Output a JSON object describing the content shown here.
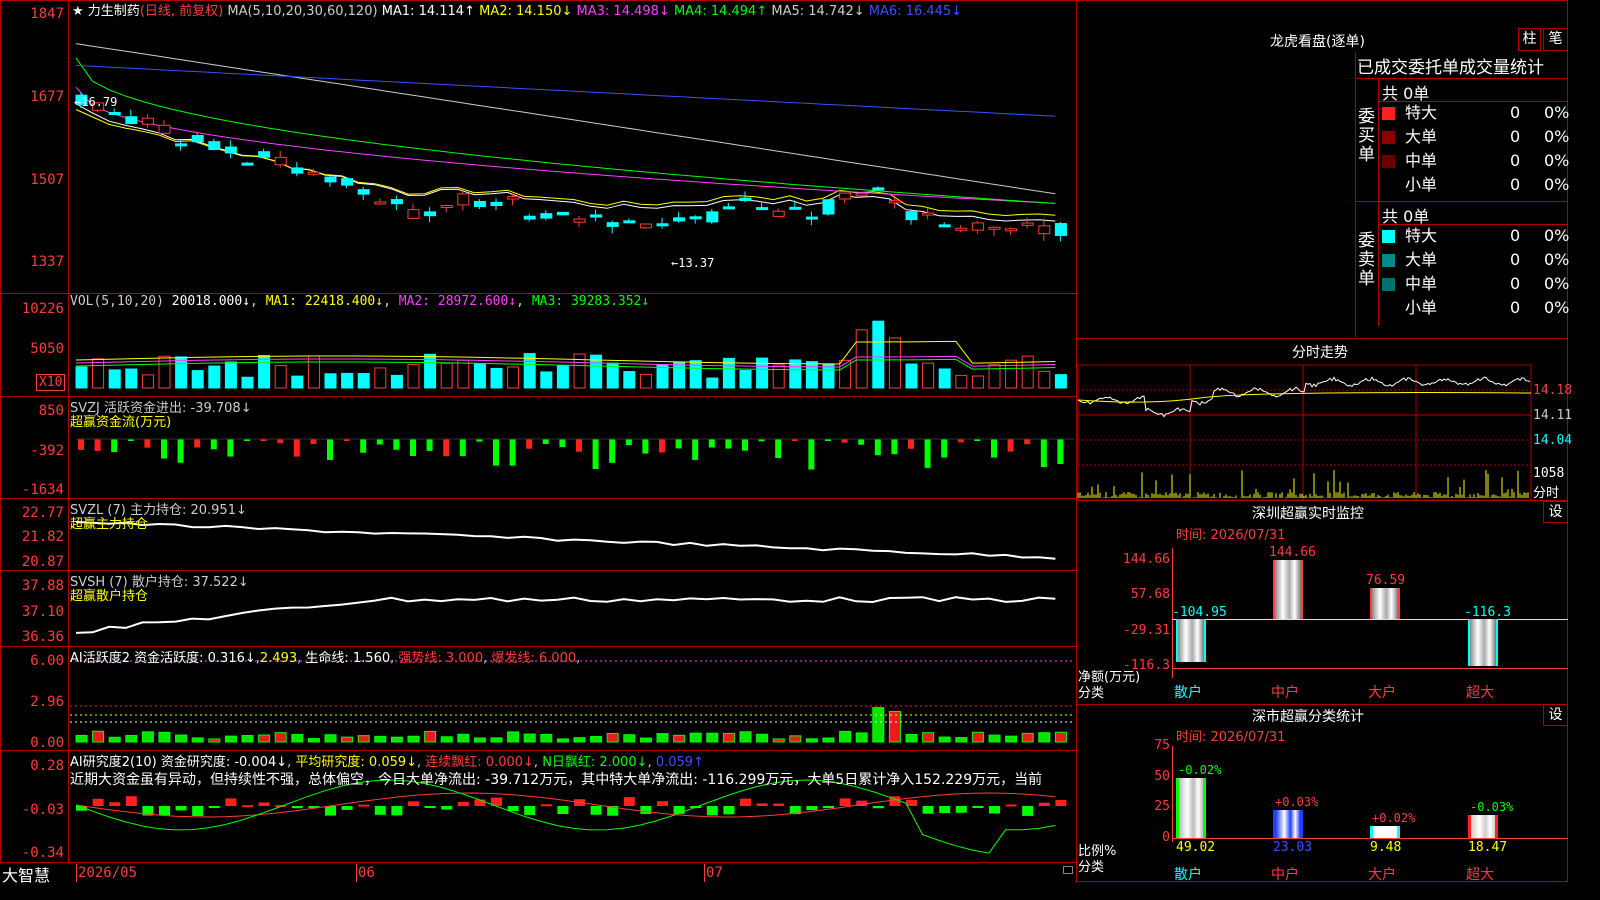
{
  "colors": {
    "up": "#ff3c3c",
    "down": "#00ffff",
    "grid": "#b00000",
    "ma1": "#ffffff",
    "ma2": "#ffff00",
    "ma3": "#ff40ff",
    "ma4": "#00ff00",
    "ma5": "#cccccc",
    "ma6": "#3c50ff"
  },
  "kline": {
    "star": "★",
    "title": "力生制药",
    "period": "(日线, 前复权)",
    "ma_label": "MA(5,10,20,30,60,120)",
    "ma1": "MA1: 14.114↑",
    "ma2": "MA2: 14.150↓",
    "ma3": "MA3: 14.498↓",
    "ma4": "MA4: 14.494↑",
    "ma5": "MA5: 14.742↓",
    "ma6": "MA6: 16.445↓",
    "yaxis": [
      "1847",
      "1677",
      "1507",
      "1337"
    ],
    "high_label": "←16.79",
    "low_label": "←13.37"
  },
  "vol": {
    "label": "VOL(5,10,20)",
    "val": "20018.000↓",
    "ma1": "MA1: 22418.400↓",
    "ma2": "MA2: 28972.600↓",
    "ma3": "MA3: 39283.352↓",
    "yaxis": [
      "10226",
      "5050"
    ],
    "unit": "X10"
  },
  "svzj": {
    "label": "SVZJ  活跃资金进出: -39.708↓",
    "sub": "超赢资金流(万元)",
    "yaxis": [
      "850",
      "-392",
      "-1634"
    ]
  },
  "svzl": {
    "label": "SVZL (7) 主力持仓: 20.951↓",
    "sub": "超赢主力持仓",
    "yaxis": [
      "22.77",
      "21.82",
      "20.87"
    ]
  },
  "svsh": {
    "label": "SVSH (7) 散户持仓: 37.522↓",
    "sub": "超赢散户持仓",
    "yaxis": [
      "37.88",
      "37.10",
      "36.36"
    ]
  },
  "ai1": {
    "a": "AI活跃度2 资金活跃度: 0.316↓",
    "b": "2.493",
    "c": "生命线: 1.560",
    "d": "强势线: 3.000",
    "e": "爆发线: 6.000",
    "yaxis": [
      "6.00",
      "2.96",
      "0.00"
    ]
  },
  "ai2": {
    "a": "AI研究度2(10) 资金研究度: -0.004↓",
    "b": "平均研究度: 0.059↓",
    "c": "连续飘红: 0.000↓",
    "d": "N日飘红: 2.000↓",
    "e": "0.059↑",
    "note": "近期大资金虽有异动，但持续性不强，总体偏空，今日大单净流出: -39.712万元，其中特大单净流出: -116.299万元，大单5日累计净入152.229万元，当前",
    "yaxis": [
      "0.28",
      "-0.03",
      "-0.34"
    ]
  },
  "xaxis": {
    "d1": "2026/05",
    "d2": "06",
    "d3": "07"
  },
  "brand": "大智慧",
  "lhkp": {
    "title": "龙虎看盘(逐单)",
    "btn1": "柱",
    "btn2": "笔",
    "header": "已成交委托单成交量统计",
    "buy_title": "委买单",
    "sell_title": "委卖单",
    "buy_total": "共 0单",
    "sell_total": "共 0单",
    "rows": [
      {
        "label": "特大",
        "val": "0",
        "pct": "0%"
      },
      {
        "label": "大单",
        "val": "0",
        "pct": "0%"
      },
      {
        "label": "中单",
        "val": "0",
        "pct": "0%"
      },
      {
        "label": "小单",
        "val": "0",
        "pct": "0%"
      }
    ]
  },
  "fenshi": {
    "title": "分时走势",
    "yaxis": [
      "14.18",
      "14.11",
      "14.04"
    ],
    "vol": "1058",
    "unit": "分时"
  },
  "szmon": {
    "title": "深圳超赢实时监控",
    "btn": "设",
    "time": "时间: 2026/07/31",
    "yaxis": [
      "144.66",
      "57.68",
      "-29.31",
      "-116.3"
    ],
    "ylabel": "净额(万元)",
    "xlabel": "分类",
    "cats": [
      "散户",
      "中户",
      "大户",
      "超大"
    ],
    "bars": [
      -104.95,
      144.66,
      76.59,
      -116.3
    ],
    "labels": [
      "-104.95",
      "144.66",
      "76.59",
      "-116.3"
    ]
  },
  "szcls": {
    "title": "深市超赢分类统计",
    "btn": "设",
    "time": "时间: 2026/07/31",
    "yaxis": [
      "75",
      "50",
      "25",
      "0"
    ],
    "ylabel": "比例%",
    "xlabel": "分类",
    "cats": [
      "散户",
      "中户",
      "大户",
      "超大"
    ],
    "values": [
      49.02,
      23.03,
      9.48,
      18.47
    ],
    "vlabels": [
      "49.02",
      "23.03",
      "9.48",
      "18.47"
    ],
    "chg": [
      "-0.02%",
      "+0.03%",
      "+0.02%",
      "-0.03%"
    ]
  }
}
